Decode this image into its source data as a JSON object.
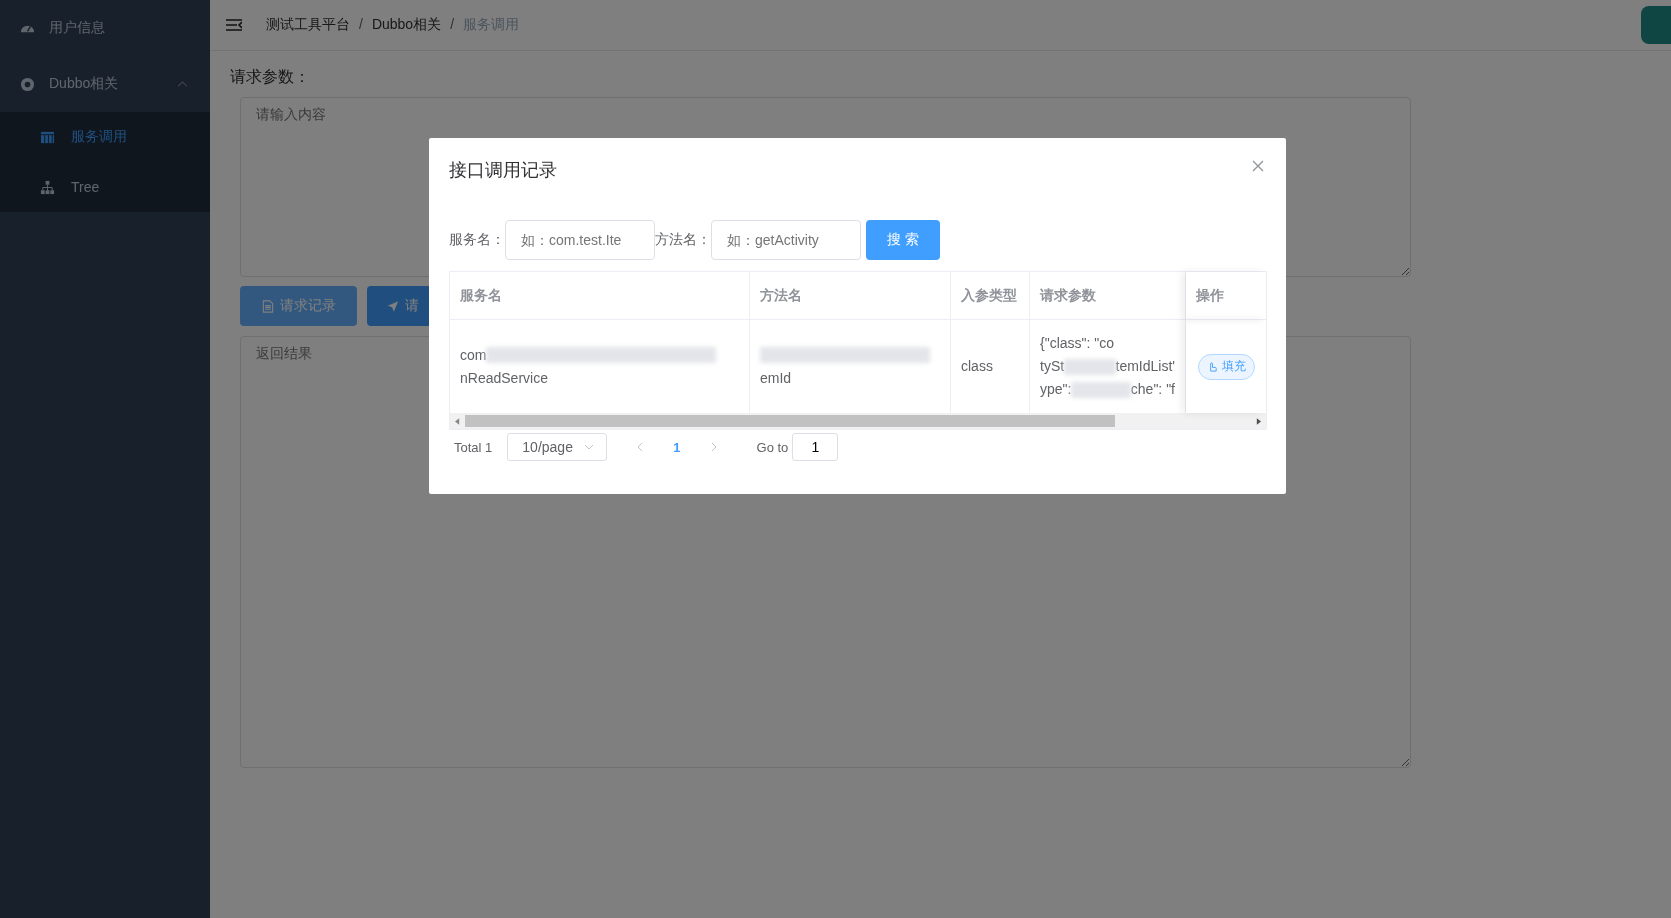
{
  "sidebar": {
    "items": [
      {
        "kind": "item",
        "label": "用户信息",
        "selected": false
      },
      {
        "kind": "group",
        "label": "Dubbo相关",
        "expanded": true,
        "children": [
          {
            "label": "服务调用",
            "selected": true
          },
          {
            "label": "Tree",
            "selected": false
          }
        ]
      }
    ]
  },
  "header": {
    "breadcrumbs": [
      "测试工具平台",
      "Dubbo相关",
      "服务调用"
    ],
    "separator": "/"
  },
  "page": {
    "params_label": "请求参数：",
    "params_placeholder": "请输入内容",
    "buttons": [
      {
        "label": "请求记录"
      },
      {
        "label": "请"
      }
    ],
    "result_placeholder": "返回结果"
  },
  "dialog": {
    "title": "接口调用记录",
    "filters": [
      {
        "label": "服务名：",
        "placeholder": "如：com.test.Ite"
      },
      {
        "label": "方法名：",
        "placeholder": "如：getActivity"
      }
    ],
    "search_button": "搜 索",
    "table": {
      "columns": [
        "服务名",
        "方法名",
        "入参类型",
        "请求参数",
        "操作"
      ],
      "rows": [
        {
          "service": [
            [
              "com"
            ],
            [
              "nReadService"
            ]
          ],
          "method": [
            [
              "emId"
            ]
          ],
          "param_type": "class",
          "params": [
            [
              "{\"class\": \"co"
            ],
            [
              "tySt",
              "temIdList'"
            ],
            [
              "ype\": ",
              "che\": \"f"
            ]
          ],
          "action": "填充"
        }
      ]
    },
    "pagination": {
      "total": "Total 1",
      "page_size": "10/page",
      "pages": [
        {
          "label": "1",
          "selected": true
        }
      ],
      "goto_label": "Go to",
      "goto_value": "1"
    }
  }
}
